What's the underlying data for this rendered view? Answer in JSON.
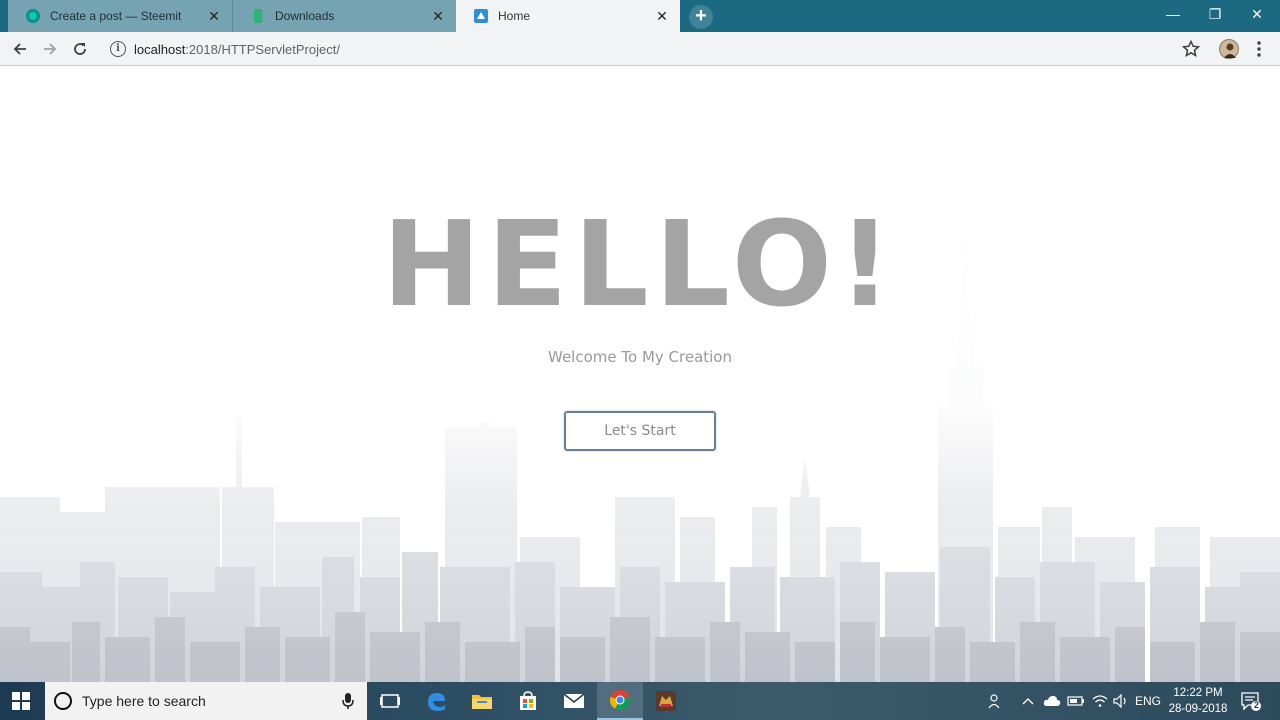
{
  "browser": {
    "tabs": [
      {
        "title": "Create a post — Steemit",
        "close": "✕"
      },
      {
        "title": "Downloads",
        "close": "✕"
      },
      {
        "title": "Home",
        "close": "✕"
      }
    ],
    "new_tab": "+",
    "url_host": "localhost",
    "url_path": ":2018/HTTPServletProject/",
    "info_icon": "i",
    "window_controls": {
      "minimize": "—",
      "maximize": "❐",
      "close": "✕"
    }
  },
  "page": {
    "title": "HELLO!",
    "subtitle": "Welcome To My Creation",
    "button_label": "Let's Start"
  },
  "taskbar": {
    "search_placeholder": "Type here to search",
    "language": "ENG",
    "time": "12:22 PM",
    "date": "28-09-2018",
    "notification_count": "2"
  },
  "colors": {
    "titlebar": "#1b6a82",
    "hero_text": "#a4a4a4",
    "button_border": "#6a7f98"
  }
}
